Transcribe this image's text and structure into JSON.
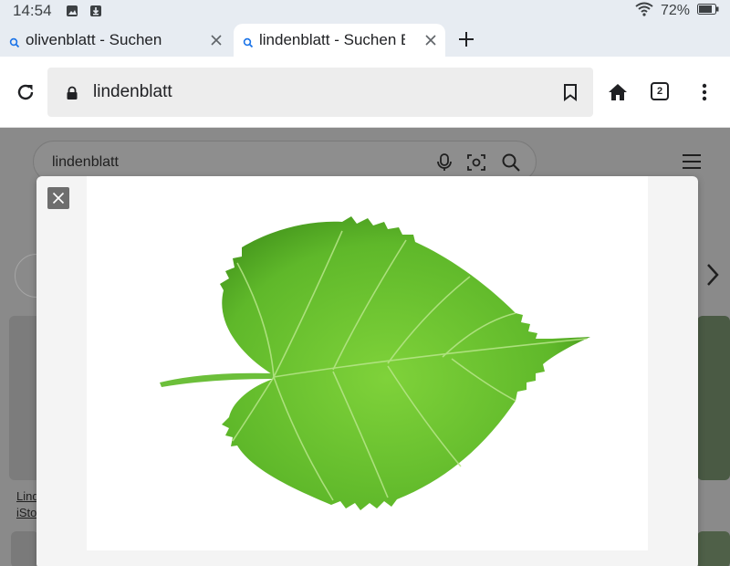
{
  "status_bar": {
    "time": "14:54",
    "battery": "72%",
    "icons": [
      "image-icon",
      "download-icon",
      "wifi-icon",
      "battery-icon"
    ]
  },
  "tabs": [
    {
      "title": "olivenblatt - Suchen",
      "active": false
    },
    {
      "title": "lindenblatt - Suchen Bilder",
      "active": true
    }
  ],
  "toolbar": {
    "url": "lindenblatt",
    "tab_count": "2"
  },
  "page": {
    "search_query": "lindenblatt",
    "caption_line1": "Lind",
    "caption_line2": "iSto"
  },
  "viewer": {
    "leaf_color": "#5fb82a",
    "leaf_dark": "#3f8f1a",
    "vein_color": "#b8e68a"
  }
}
